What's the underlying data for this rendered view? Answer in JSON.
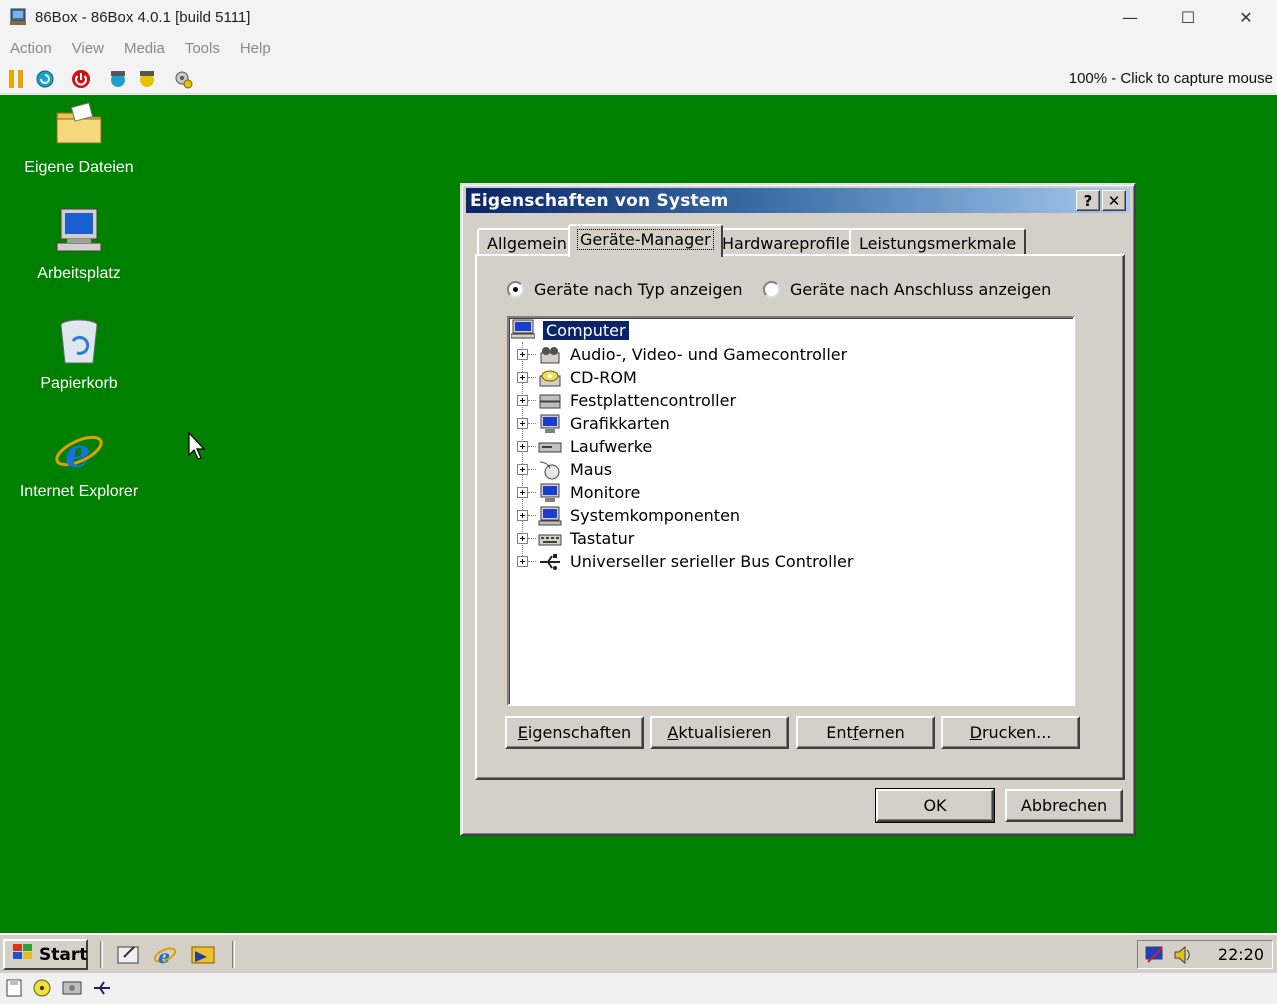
{
  "host": {
    "title": "86Box - 86Box 4.0.1 [build 5111]",
    "menu": [
      "Action",
      "View",
      "Media",
      "Tools",
      "Help"
    ],
    "status_right": "100% - Click to capture mouse",
    "window_controls": {
      "minimize": "—",
      "maximize": "☐",
      "close": "✕"
    }
  },
  "desktop": {
    "background": "#008000",
    "icons": [
      {
        "label": "Eigene Dateien",
        "icon": "folder-icon"
      },
      {
        "label": "Arbeitsplatz",
        "icon": "computer-icon"
      },
      {
        "label": "Papierkorb",
        "icon": "recycle-bin-icon"
      },
      {
        "label": "Internet Explorer",
        "icon": "internet-explorer-icon"
      }
    ]
  },
  "dialog": {
    "title": "Eigenschaften von System",
    "help_btn": "?",
    "close_btn": "✕",
    "tabs": [
      "Allgemein",
      "Geräte-Manager",
      "Hardwareprofile",
      "Leistungsmerkmale"
    ],
    "active_tab": "Geräte-Manager",
    "radio": {
      "by_type": "Geräte nach Typ anzeigen",
      "by_connection": "Geräte nach Anschluss anzeigen"
    },
    "tree": {
      "root": "Computer",
      "items": [
        "Audio-, Video- und Gamecontroller",
        "CD-ROM",
        "Festplattencontroller",
        "Grafikkarten",
        "Laufwerke",
        "Maus",
        "Monitore",
        "Systemkomponenten",
        "Tastatur",
        "Universeller serieller Bus Controller"
      ]
    },
    "buttons": {
      "eigenschaften": {
        "pre": "",
        "u": "E",
        "post": "igenschaften"
      },
      "aktualisieren": {
        "pre": "",
        "u": "A",
        "post": "ktualisieren"
      },
      "entfernen": {
        "pre": "Ent",
        "u": "f",
        "post": "ernen"
      },
      "drucken": {
        "pre": "",
        "u": "D",
        "post": "rucken..."
      },
      "ok": "OK",
      "abbrechen": "Abbrechen"
    }
  },
  "taskbar": {
    "start": "Start",
    "clock": "22:20"
  }
}
